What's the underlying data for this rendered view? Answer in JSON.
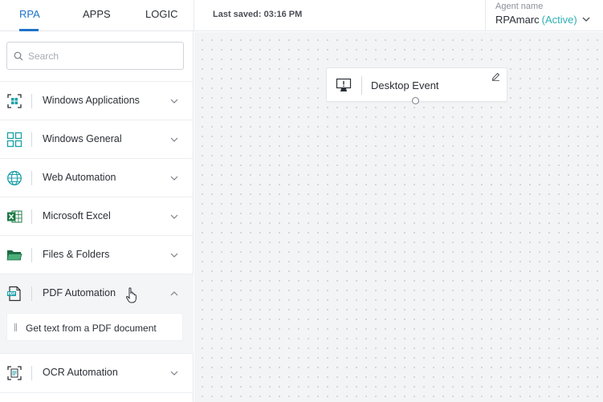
{
  "tabs": [
    {
      "label": "RPA",
      "active": true
    },
    {
      "label": "APPS",
      "active": false
    },
    {
      "label": "LOGIC",
      "active": false
    }
  ],
  "header": {
    "last_saved": "Last saved: 03:16 PM",
    "agent_label": "Agent name",
    "agent_name": "RPAmarc",
    "agent_status": "(Active)"
  },
  "search": {
    "placeholder": "Search",
    "value": ""
  },
  "categories": [
    {
      "label": "Windows Applications",
      "icon": "windows-app-icon",
      "expanded": false
    },
    {
      "label": "Windows General",
      "icon": "windows-grid-icon",
      "expanded": false
    },
    {
      "label": "Web Automation",
      "icon": "globe-icon",
      "expanded": false
    },
    {
      "label": "Microsoft Excel",
      "icon": "excel-icon",
      "expanded": false
    },
    {
      "label": "Files & Folders",
      "icon": "folder-icon",
      "expanded": false
    },
    {
      "label": "PDF Automation",
      "icon": "pdf-icon",
      "expanded": true
    },
    {
      "label": "OCR Automation",
      "icon": "ocr-icon",
      "expanded": false
    }
  ],
  "pdf_items": [
    {
      "label": "Get text from a PDF document"
    }
  ],
  "canvas": {
    "node": {
      "label": "Desktop Event",
      "icon": "desktop-event-icon"
    }
  },
  "colors": {
    "accent": "#1e73c8",
    "active_status": "#2fb0b6",
    "icon_teal": "#1aa0a8",
    "excel_green": "#1d7a45"
  }
}
